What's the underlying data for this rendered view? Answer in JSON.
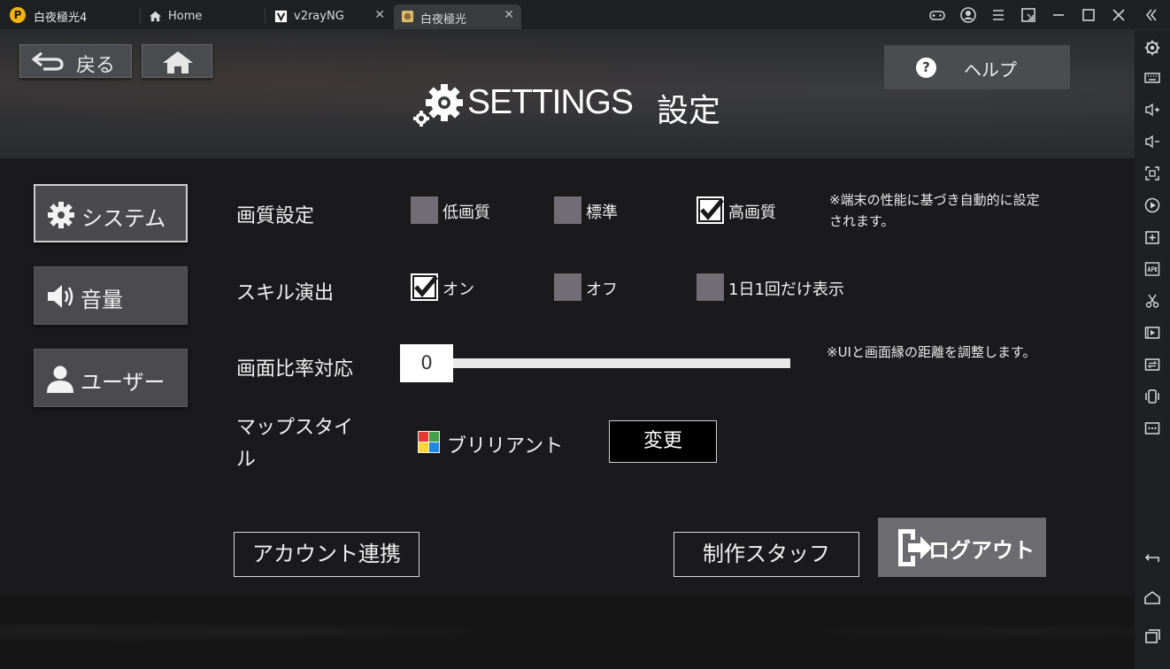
{
  "window": {
    "app_title": "白夜極光4",
    "tabs": [
      {
        "label": "Home",
        "icon": "home-icon",
        "active": false
      },
      {
        "label": "v2rayNG",
        "icon": "v2rayng-app-icon",
        "active": false,
        "closable": true
      },
      {
        "label": "白夜極光",
        "icon": "game-app-icon",
        "active": true,
        "closable": true
      }
    ],
    "controls": [
      "gamepad-icon",
      "account-icon",
      "menu-icon",
      "popout-icon",
      "minimize-icon",
      "maximize-icon",
      "close-icon",
      "collapse-sidebar-icon"
    ]
  },
  "header": {
    "back_label": "戻る",
    "help_label": "ヘルプ",
    "help_symbol": "?",
    "title_en": "SETTINGS",
    "title_ja": "設定"
  },
  "menu": [
    {
      "label": "システム",
      "icon": "gear-icon",
      "active": true
    },
    {
      "label": "音量",
      "icon": "speaker-icon",
      "active": false
    },
    {
      "label": "ユーザー",
      "icon": "user-icon",
      "active": false
    }
  ],
  "settings": {
    "quality": {
      "label": "画質設定",
      "options": [
        {
          "label": "低画質",
          "checked": false
        },
        {
          "label": "標準",
          "checked": false
        },
        {
          "label": "高画質",
          "checked": true
        }
      ],
      "note": "※端末の性能に基づき自動的に設定されます。"
    },
    "skill": {
      "label": "スキル演出",
      "options": [
        {
          "label": "オン",
          "checked": true
        },
        {
          "label": "オフ",
          "checked": false
        },
        {
          "label": "1日1回だけ表示",
          "checked": false
        }
      ]
    },
    "ratio": {
      "label": "画面比率対応",
      "value": "0",
      "note": "※UIと画面縁の距離を調整します。"
    },
    "map": {
      "label": "マップスタイル",
      "current": "ブリリアント",
      "change_label": "変更"
    }
  },
  "footer": {
    "account_link_label": "アカウント連携",
    "staff_label": "制作スタッフ",
    "logout_label": "ログアウト"
  },
  "sidebar_icons": [
    "settings-icon",
    "keyboard-icon",
    "volume-up-icon",
    "volume-down-icon",
    "screenshot-icon",
    "record-icon",
    "add-icon",
    "apk-icon",
    "cut-icon",
    "video-icon",
    "sync-icon",
    "shake-icon",
    "more-icon",
    "back-nav-icon",
    "home-nav-icon",
    "recent-apps-icon"
  ],
  "colors": {
    "panel_bg": "#1a1a1c",
    "button_bg": "#4b4b4e",
    "checkbox_off": "#706d74",
    "logout_bg": "#6c6c70"
  }
}
